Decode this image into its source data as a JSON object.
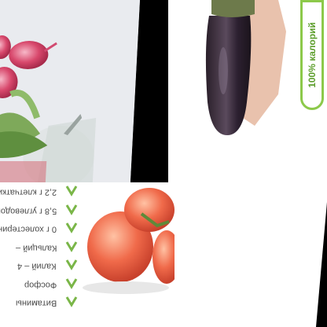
{
  "badge": {
    "text": "100% калорий"
  },
  "nutrition": {
    "rows": [
      {
        "text": "2,2 г клетчатки"
      },
      {
        "text": "5,8 г углеводов"
      },
      {
        "text": "0 г холестерина"
      },
      {
        "text": "Кальций –"
      },
      {
        "text": "Калий – 4"
      },
      {
        "text": "Фосфор"
      },
      {
        "text": "Витамины"
      }
    ]
  },
  "colors": {
    "check": "#7ab648",
    "badge_border": "#8cc94a"
  }
}
